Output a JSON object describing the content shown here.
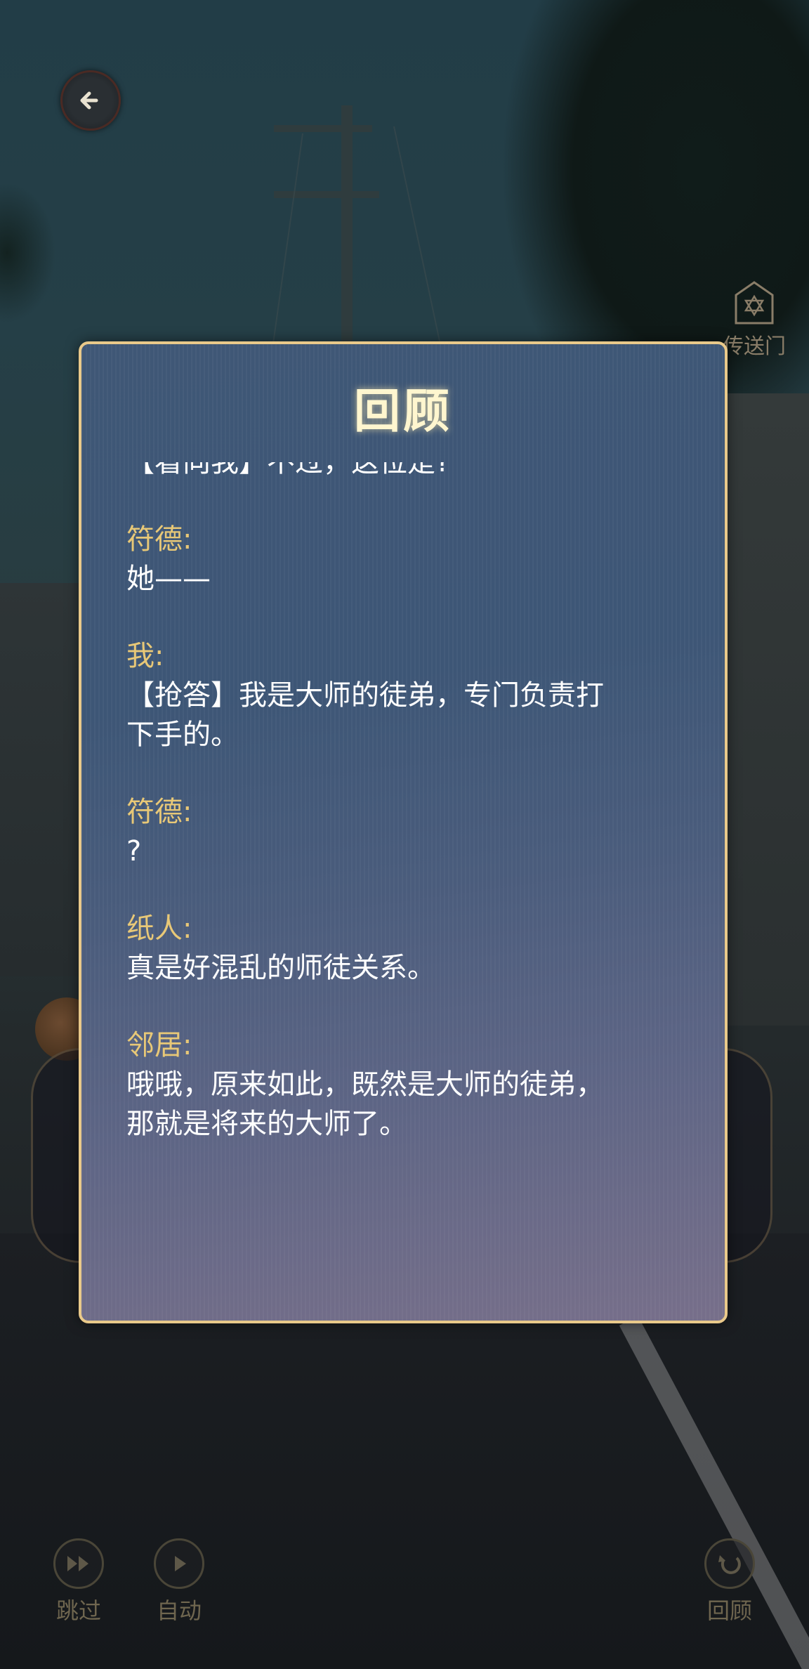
{
  "top": {
    "back_icon": "back-arrow-icon",
    "portal_label": "传送门",
    "portal_icon": "hexagram-gate-icon"
  },
  "review": {
    "title": "回顾",
    "partial_line": "【看向我】不过，这位是?",
    "entries": [
      {
        "speaker": "符德:",
        "text": "她——"
      },
      {
        "speaker": "我:",
        "text": "【抢答】我是大师的徒弟，专门负责打\n下手的。"
      },
      {
        "speaker": "符德:",
        "text": "?"
      },
      {
        "speaker": "纸人:",
        "text": "真是好混乱的师徒关系。"
      },
      {
        "speaker": "邻居:",
        "text": "哦哦，原来如此，既然是大师的徒弟，\n那就是将来的大师了。"
      }
    ]
  },
  "controls": {
    "skip_label": "跳过",
    "auto_label": "自动",
    "review_label": "回顾"
  },
  "colors": {
    "panel_border": "#e9c98a",
    "speaker": "#e8c877",
    "dialogue": "#ffffff"
  }
}
